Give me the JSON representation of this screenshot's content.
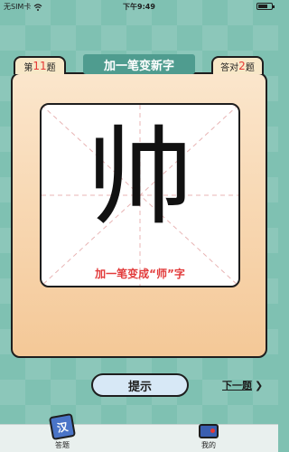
{
  "status_bar": {
    "carrier": "无SIM卡",
    "time": "下午9:49"
  },
  "header": {
    "title": "加一笔变新字",
    "question_prefix": "第",
    "question_number": "11",
    "question_suffix": "题",
    "correct_prefix": "答对",
    "correct_count": "2",
    "correct_suffix": "题"
  },
  "puzzle": {
    "character": "帅",
    "hint": "加一笔变成“师”字"
  },
  "actions": {
    "hint_button": "提示",
    "next_button": "下一题",
    "next_arrow": "❯"
  },
  "tabbar": {
    "answer_icon_char": "汉",
    "answer_label": "答题",
    "mine_label": "我的"
  },
  "icons": {
    "wifi": "wifi-icon",
    "battery": "battery-icon",
    "answer": "answer-icon",
    "mine": "wallet-icon"
  },
  "colors": {
    "background": "#7fc1b2",
    "banner": "#4f9c8f",
    "hint_text": "#e23b3b",
    "highlight": "#e53935",
    "button": "#d7e8f6"
  }
}
